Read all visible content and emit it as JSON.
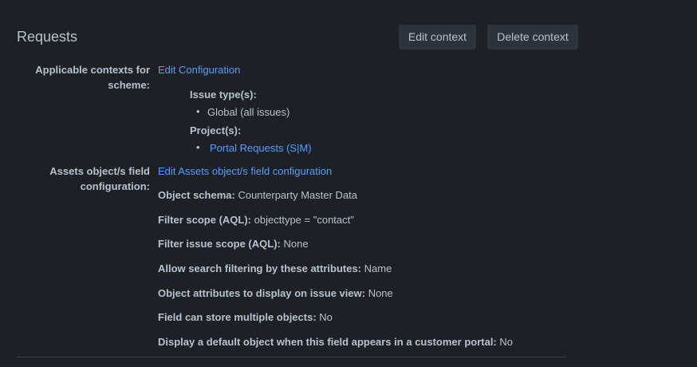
{
  "section": {
    "title": "Requests",
    "edit_context_label": "Edit context",
    "delete_context_label": "Delete context"
  },
  "contexts": {
    "label": "Applicable contexts for scheme:",
    "edit_link": "Edit Configuration",
    "issue_types_heading": "Issue type(s):",
    "issue_types": [
      "Global (all issues)"
    ],
    "projects_heading": "Project(s):",
    "projects": [
      "Portal Requests (S|M)"
    ]
  },
  "assets": {
    "label": "Assets object/s field configuration:",
    "edit_link": "Edit Assets object/s field configuration",
    "rows": [
      {
        "key": "Object schema:",
        "value": "Counterparty Master Data"
      },
      {
        "key": "Filter scope (AQL):",
        "value": "objecttype = \"contact\""
      },
      {
        "key": "Filter issue scope (AQL):",
        "value": "None"
      },
      {
        "key": "Allow search filtering by these attributes:",
        "value": "Name"
      },
      {
        "key": "Object attributes to display on issue view:",
        "value": "None"
      },
      {
        "key": "Field can store multiple objects:",
        "value": "No"
      },
      {
        "key": "Display a default object when this field appears in a customer portal:",
        "value": "No"
      }
    ]
  }
}
